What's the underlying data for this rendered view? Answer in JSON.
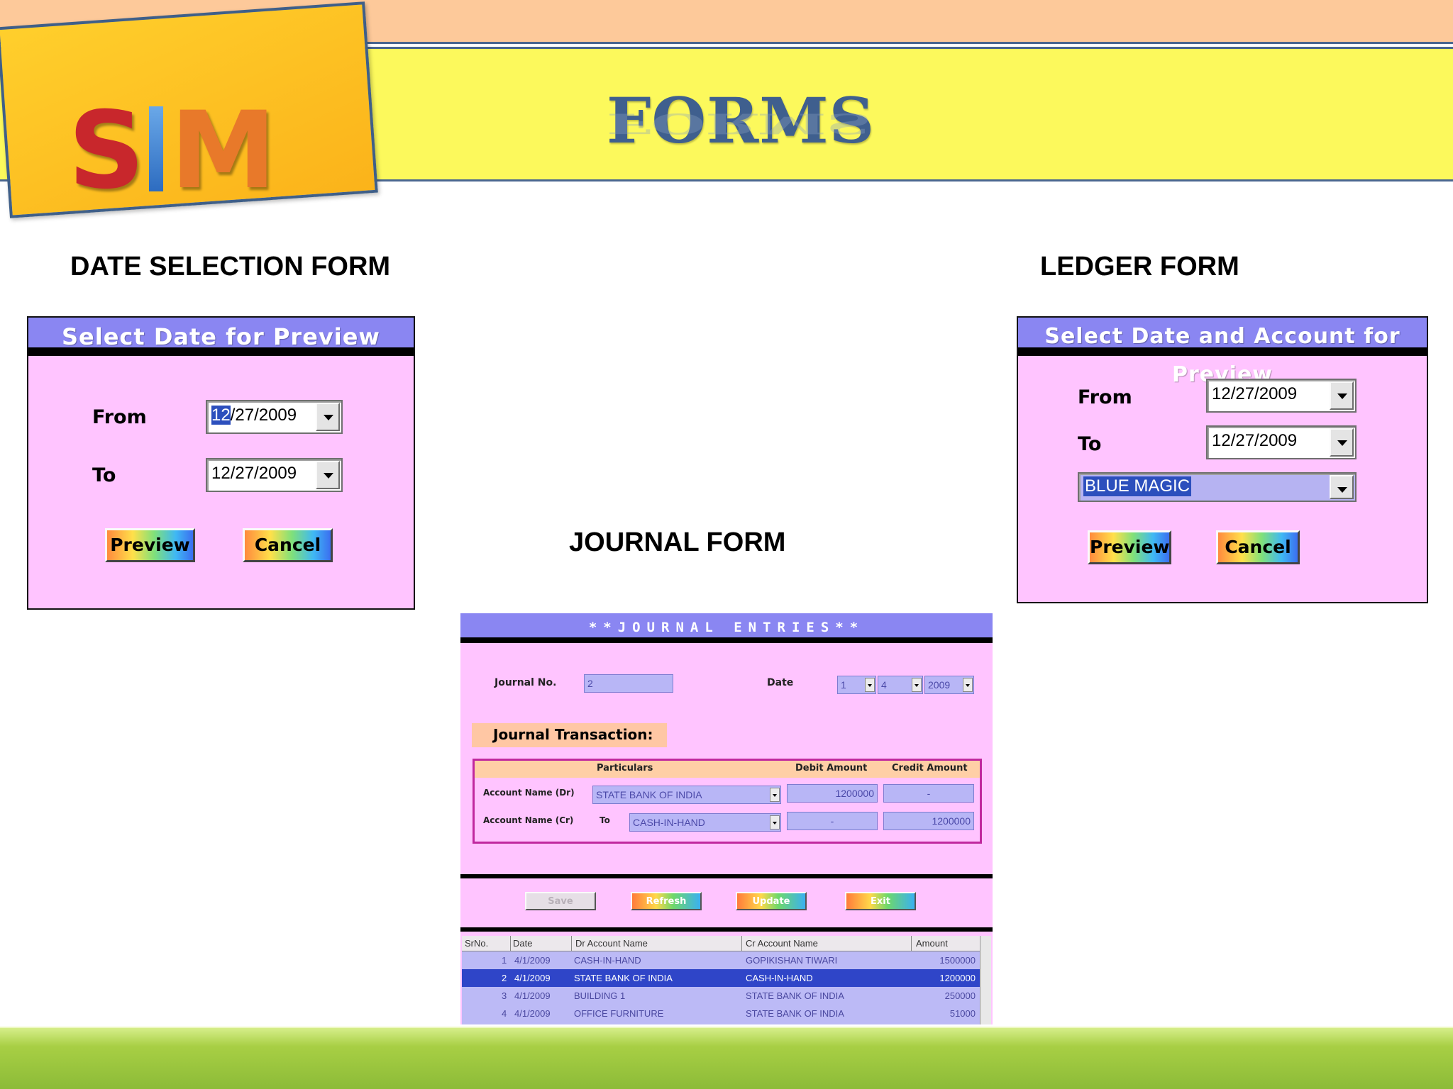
{
  "header": {
    "title": "FORMS",
    "logo": {
      "s": "S",
      "m": "M"
    }
  },
  "date_selection": {
    "heading": "DATE SELECTION FORM",
    "dialog_title": "Select Date for Preview",
    "from_label": "From",
    "from_value_selected": "12",
    "from_value_rest": "/27/2009",
    "to_label": "To",
    "to_value": "12/27/2009",
    "preview_label": "Preview",
    "cancel_label": "Cancel"
  },
  "ledger": {
    "heading": "LEDGER FORM",
    "dialog_title": "Select Date and Account for Preview",
    "from_label": "From",
    "from_value": "12/27/2009",
    "to_label": "To",
    "to_value": "12/27/2009",
    "account_value": "BLUE MAGIC",
    "preview_label": "Preview",
    "cancel_label": "Cancel"
  },
  "journal": {
    "heading": "JOURNAL FORM",
    "title": "**JOURNAL ENTRIES**",
    "journal_no_label": "Journal No.",
    "journal_no_value": "2",
    "date_label": "Date",
    "date_day": "1",
    "date_month": "4",
    "date_year": "2009",
    "section_title": "Journal Transaction:",
    "grid_headers": {
      "particulars": "Particulars",
      "debit": "Debit Amount",
      "credit": "Credit Amount"
    },
    "dr_label": "Account Name (Dr)",
    "dr_account": "STATE BANK OF INDIA",
    "dr_debit": "1200000",
    "dr_credit": "-",
    "cr_label": "Account Name (Cr)",
    "cr_to": "To",
    "cr_account": "CASH-IN-HAND",
    "cr_debit": "-",
    "cr_credit": "1200000",
    "buttons": {
      "save": "Save",
      "refresh": "Refresh",
      "update": "Update",
      "exit": "Exit"
    },
    "table": {
      "headers": [
        "SrNo.",
        "Date",
        "Dr  Account Name",
        "Cr  Account Name",
        "Amount"
      ],
      "rows": [
        {
          "no": "1",
          "date": "4/1/2009",
          "dr": "CASH-IN-HAND",
          "cr": "GOPIKISHAN TIWARI",
          "amount": "1500000"
        },
        {
          "no": "2",
          "date": "4/1/2009",
          "dr": "STATE BANK OF INDIA",
          "cr": "CASH-IN-HAND",
          "amount": "1200000"
        },
        {
          "no": "3",
          "date": "4/1/2009",
          "dr": "BUILDING 1",
          "cr": "STATE BANK OF INDIA",
          "amount": "250000"
        },
        {
          "no": "4",
          "date": "4/1/2009",
          "dr": "OFFICE FURNITURE",
          "cr": "STATE BANK OF INDIA",
          "amount": "51000"
        }
      ]
    }
  },
  "colors": {
    "header_strip": "#fdc99a",
    "header_band": "#fcf95c",
    "dialog_title_bg": "#8a86f2",
    "dialog_bg": "#ffc4ff",
    "footer": "#8cbb38"
  }
}
